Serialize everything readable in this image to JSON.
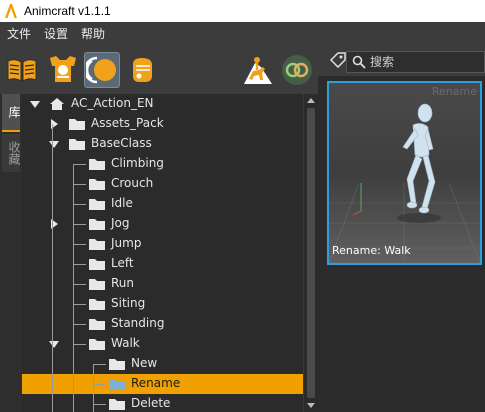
{
  "window": {
    "title": "Animcraft v1.1.1",
    "accent": "#f0a000"
  },
  "menu": {
    "items": [
      "文件",
      "设置",
      "帮助"
    ]
  },
  "toolbar": {
    "buttons": [
      {
        "icon": "book-icon"
      },
      {
        "icon": "armor-icon"
      },
      {
        "icon": "motion-ring-icon",
        "active": true
      },
      {
        "icon": "glove-icon"
      },
      {
        "icon": "horse-rider-icon"
      },
      {
        "icon": "link-rings-icon"
      }
    ]
  },
  "search": {
    "placeholder": "搜索"
  },
  "left_tabs": [
    "库",
    "收藏"
  ],
  "tree": [
    {
      "label": "AC_Action_EN",
      "level": 0,
      "type": "root",
      "expanded": true
    },
    {
      "label": "Assets_Pack",
      "level": 1,
      "type": "folder",
      "expanded": false
    },
    {
      "label": "BaseClass",
      "level": 1,
      "type": "folder",
      "expanded": true
    },
    {
      "label": "Climbing",
      "level": 2,
      "type": "folder"
    },
    {
      "label": "Crouch",
      "level": 2,
      "type": "folder"
    },
    {
      "label": "Idle",
      "level": 2,
      "type": "folder"
    },
    {
      "label": "Jog",
      "level": 2,
      "type": "folder",
      "expanded": false
    },
    {
      "label": "Jump",
      "level": 2,
      "type": "folder"
    },
    {
      "label": "Left",
      "level": 2,
      "type": "folder"
    },
    {
      "label": "Run",
      "level": 2,
      "type": "folder"
    },
    {
      "label": "Siting",
      "level": 2,
      "type": "folder"
    },
    {
      "label": "Standing",
      "level": 2,
      "type": "folder"
    },
    {
      "label": "Walk",
      "level": 2,
      "type": "folder",
      "expanded": true
    },
    {
      "label": "New",
      "level": 3,
      "type": "folder"
    },
    {
      "label": "Rename",
      "level": 3,
      "type": "folder",
      "selected": true
    },
    {
      "label": "Delete",
      "level": 3,
      "type": "folder"
    }
  ],
  "preview": {
    "corner_label": "Rename",
    "caption": "Rename: Walk",
    "border_color": "#2d9fdc"
  }
}
